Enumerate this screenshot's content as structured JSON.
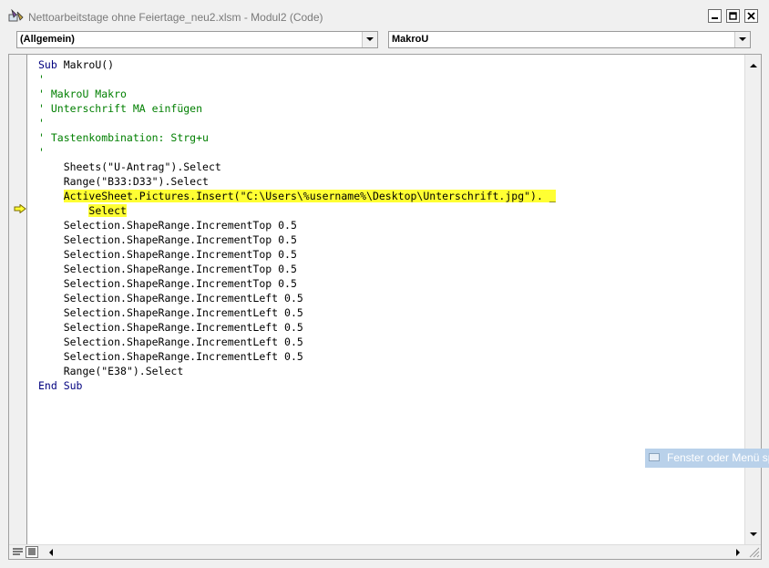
{
  "window": {
    "title": "Nettoarbeitstage ohne Feiertage_neu2.xlsm - Modul2 (Code)",
    "icon": "vba-editor-icon",
    "buttons": [
      "minimize-icon",
      "maximize-icon",
      "close-icon"
    ]
  },
  "combos": {
    "object": "(Allgemein)",
    "procedure": "MakroU"
  },
  "code": {
    "lines": [
      {
        "indent": "",
        "parts": [
          [
            "kw",
            "Sub"
          ],
          [
            "tx",
            " MakroU()"
          ]
        ]
      },
      {
        "indent": "",
        "parts": [
          [
            "cm",
            "'"
          ]
        ]
      },
      {
        "indent": "",
        "parts": [
          [
            "cm",
            "' MakroU Makro"
          ]
        ]
      },
      {
        "indent": "",
        "parts": [
          [
            "cm",
            "' Unterschrift MA einfügen"
          ]
        ]
      },
      {
        "indent": "",
        "parts": [
          [
            "cm",
            "'"
          ]
        ]
      },
      {
        "indent": "",
        "parts": [
          [
            "cm",
            "' Tastenkombination: Strg+u"
          ]
        ]
      },
      {
        "indent": "",
        "parts": [
          [
            "cm",
            "'"
          ]
        ]
      },
      {
        "indent": "    ",
        "parts": [
          [
            "tx",
            "Sheets(\"U-Antrag\").Select"
          ]
        ]
      },
      {
        "indent": "    ",
        "parts": [
          [
            "tx",
            "Range(\"B33:D33\").Select"
          ]
        ]
      },
      {
        "indent": "    ",
        "parts": [
          [
            "hl",
            "ActiveSheet.Pictures.Insert(\"C:\\Users\\%username%\\Desktop\\Unterschrift.jpg\"). _"
          ]
        ]
      },
      {
        "indent": "        ",
        "parts": [
          [
            "hl",
            "Select"
          ]
        ]
      },
      {
        "indent": "    ",
        "parts": [
          [
            "tx",
            "Selection.ShapeRange.IncrementTop 0.5"
          ]
        ]
      },
      {
        "indent": "    ",
        "parts": [
          [
            "tx",
            "Selection.ShapeRange.IncrementTop 0.5"
          ]
        ]
      },
      {
        "indent": "    ",
        "parts": [
          [
            "tx",
            "Selection.ShapeRange.IncrementTop 0.5"
          ]
        ]
      },
      {
        "indent": "    ",
        "parts": [
          [
            "tx",
            "Selection.ShapeRange.IncrementTop 0.5"
          ]
        ]
      },
      {
        "indent": "    ",
        "parts": [
          [
            "tx",
            "Selection.ShapeRange.IncrementTop 0.5"
          ]
        ]
      },
      {
        "indent": "    ",
        "parts": [
          [
            "tx",
            "Selection.ShapeRange.IncrementLeft 0.5"
          ]
        ]
      },
      {
        "indent": "    ",
        "parts": [
          [
            "tx",
            "Selection.ShapeRange.IncrementLeft 0.5"
          ]
        ]
      },
      {
        "indent": "    ",
        "parts": [
          [
            "tx",
            "Selection.ShapeRange.IncrementLeft 0.5"
          ]
        ]
      },
      {
        "indent": "    ",
        "parts": [
          [
            "tx",
            "Selection.ShapeRange.IncrementLeft 0.5"
          ]
        ]
      },
      {
        "indent": "    ",
        "parts": [
          [
            "tx",
            "Selection.ShapeRange.IncrementLeft 0.5"
          ]
        ]
      },
      {
        "indent": "    ",
        "parts": [
          [
            "tx",
            "Range(\"E38\").Select"
          ]
        ]
      },
      {
        "indent": "",
        "parts": [
          [
            "kw",
            "End Sub"
          ]
        ]
      }
    ],
    "execution_line": 10,
    "highlight_color": "#ffff33",
    "keyword_color": "#00007f",
    "comment_color": "#007f00"
  },
  "tooltip": {
    "text": "Fenster oder Menü sp"
  }
}
